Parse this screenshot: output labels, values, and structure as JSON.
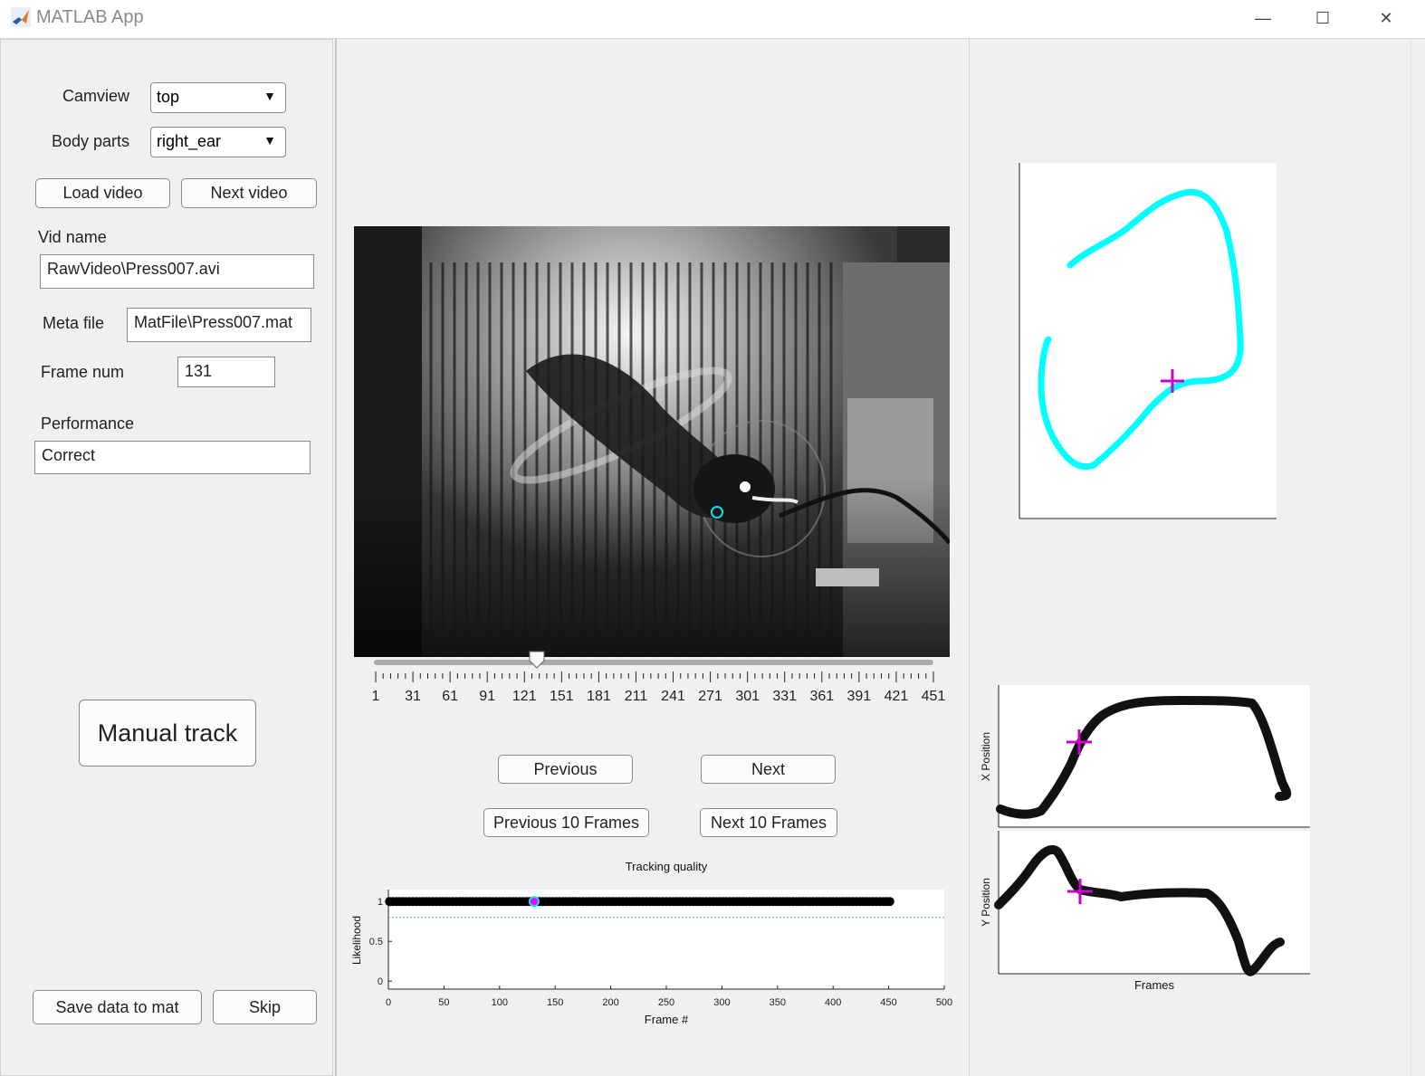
{
  "window": {
    "title": "MATLAB App",
    "controls": [
      "—",
      "☐",
      "✕"
    ]
  },
  "left": {
    "camview_label": "Camview",
    "camview_value": "top",
    "bodyparts_label": "Body parts",
    "bodyparts_value": "right_ear",
    "load_video": "Load video",
    "next_video": "Next video",
    "vidname_label": "Vid name",
    "vidname_value": "RawVideo\\Press007.avi",
    "metafile_label": "Meta file",
    "metafile_value": "MatFile\\Press007.mat",
    "framenum_label": "Frame num",
    "framenum_value": "131",
    "performance_label": "Performance",
    "performance_value": "Correct",
    "manual_track": "Manual track",
    "save_data": "Save data to mat",
    "skip": "Skip"
  },
  "center": {
    "slider": {
      "min": 1,
      "max": 451,
      "value": 131,
      "tick_labels": [
        "1",
        "31",
        "61",
        "91",
        "121",
        "151",
        "181",
        "211",
        "241",
        "271",
        "301",
        "331",
        "361",
        "391",
        "421",
        "451"
      ]
    },
    "buttons": {
      "previous": "Previous",
      "next": "Next",
      "previous10": "Previous 10 Frames",
      "next10": "Next 10 Frames"
    }
  },
  "chart_data": [
    {
      "type": "scatter",
      "title": "Tracking quality",
      "xlabel": "Frame #",
      "ylabel": "Likelihood",
      "xlim": [
        0,
        500
      ],
      "ylim": [
        -0.1,
        1.15
      ],
      "xticks": [
        "0",
        "50",
        "100",
        "150",
        "200",
        "250",
        "300",
        "350",
        "400",
        "450",
        "500"
      ],
      "yticks": [
        "0",
        "0.5",
        "1"
      ],
      "threshold": 0.8,
      "series": [
        {
          "x_range": [
            1,
            451
          ],
          "y": 1.0,
          "color": "#000000"
        }
      ],
      "current": {
        "x": 131,
        "y": 1.0,
        "color": "#ff00ff",
        "ring": "#00e5ee"
      }
    },
    {
      "type": "line",
      "title": "",
      "ylabel": "",
      "trace_color": "#00ffff",
      "current_marker_color": "#ff00ff"
    },
    {
      "type": "scatter",
      "ylabel": "X Position",
      "xlabel": "",
      "current_marker_color": "#ff00ff"
    },
    {
      "type": "scatter",
      "ylabel": "Y Position",
      "xlabel": "Frames",
      "current_marker_color": "#ff00ff"
    }
  ]
}
